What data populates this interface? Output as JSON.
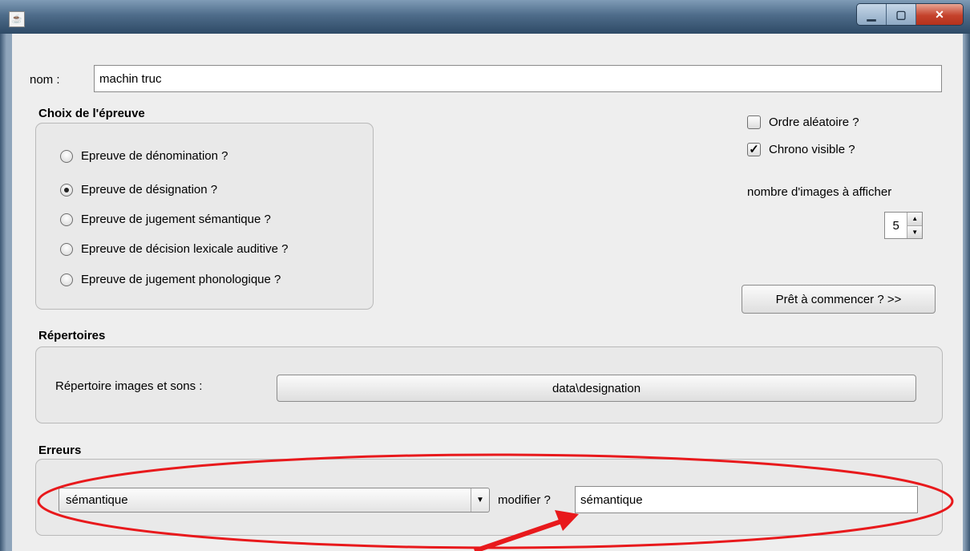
{
  "window": {
    "app_icon": "java-icon"
  },
  "name_field": {
    "label": "nom :",
    "value": "machin truc"
  },
  "choix": {
    "header": "Choix de l'épreuve",
    "options": [
      {
        "label": "Epreuve de dénomination ?",
        "selected": false
      },
      {
        "label": "Epreuve de désignation ?",
        "selected": true
      },
      {
        "label": "Epreuve de jugement sémantique ?",
        "selected": false
      },
      {
        "label": "Epreuve de décision lexicale auditive ?",
        "selected": false
      },
      {
        "label": "Epreuve de jugement phonologique ?",
        "selected": false
      }
    ]
  },
  "options": {
    "random_order": {
      "label": "Ordre aléatoire ?",
      "checked": false
    },
    "chrono": {
      "label": "Chrono visible ?",
      "checked": true
    },
    "images_count_label": "nombre d'images à afficher",
    "images_count": "5",
    "start_button": "Prêt à commencer ? >>"
  },
  "repertoires": {
    "header": "Répertoires",
    "label": "Répertoire images et sons :",
    "path": "data\\designation"
  },
  "erreurs": {
    "header": "Erreurs",
    "selected": "sémantique",
    "modify_label": "modifier ?",
    "modify_value": "sémantique"
  },
  "annotation_color": "#e8191c"
}
